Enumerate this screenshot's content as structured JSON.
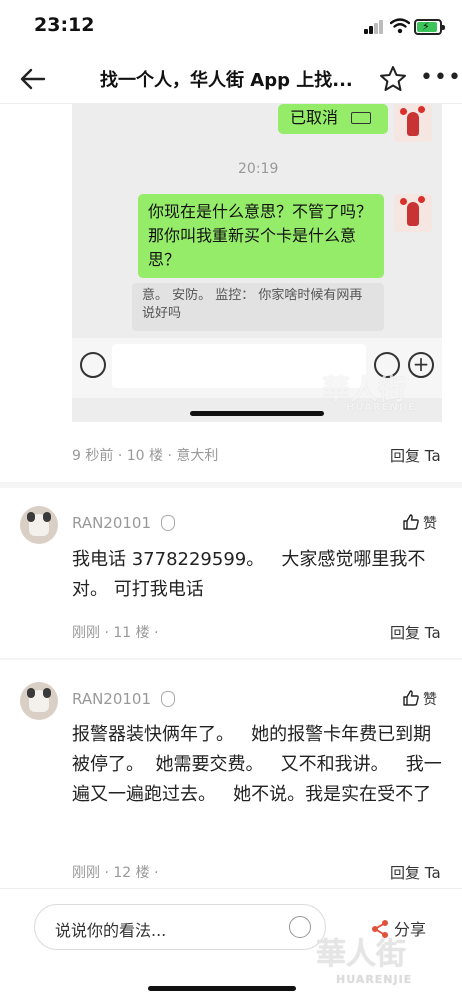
{
  "status": {
    "time": "23:12"
  },
  "nav": {
    "title": "找一个人，华人街 App 上找..."
  },
  "embed": {
    "cancel_bubble": "已取消",
    "time": "20:19",
    "message": "你现在是什么意思？不管了吗？那你叫我重新买个卡是什么意思？",
    "quote": "意。 安防。 监控：  你家啥时候有网再说好吗",
    "watermark_cn": "華人街",
    "watermark_en": "HUARENJIE"
  },
  "post10": {
    "time": "9 秒前",
    "floor": "10 楼",
    "location": "意大利",
    "reply": "回复 Ta"
  },
  "comments": [
    {
      "user": "RAN20101",
      "like": "赞",
      "text": "我电话 3778229599。   大家感觉哪里我不对。 可打我电话",
      "time": "刚刚",
      "floor": "11 楼",
      "reply": "回复 Ta"
    },
    {
      "user": "RAN20101",
      "like": "赞",
      "text": "报警器装快俩年了。   她的报警卡年费已到期被停了。  她需要交费。   又不和我讲。   我一遍又一遍跑过去。   她不说。我是实在受不了",
      "time": "刚刚",
      "floor": "12 楼",
      "reply": "回复 Ta"
    }
  ],
  "bottom": {
    "placeholder": "说说你的看法...",
    "share": "分享",
    "watermark_cn": "華人街",
    "watermark_en": "HUARENJIE"
  },
  "colors": {
    "bubble_green": "#95ec69",
    "battery_green": "#3bc45a"
  }
}
